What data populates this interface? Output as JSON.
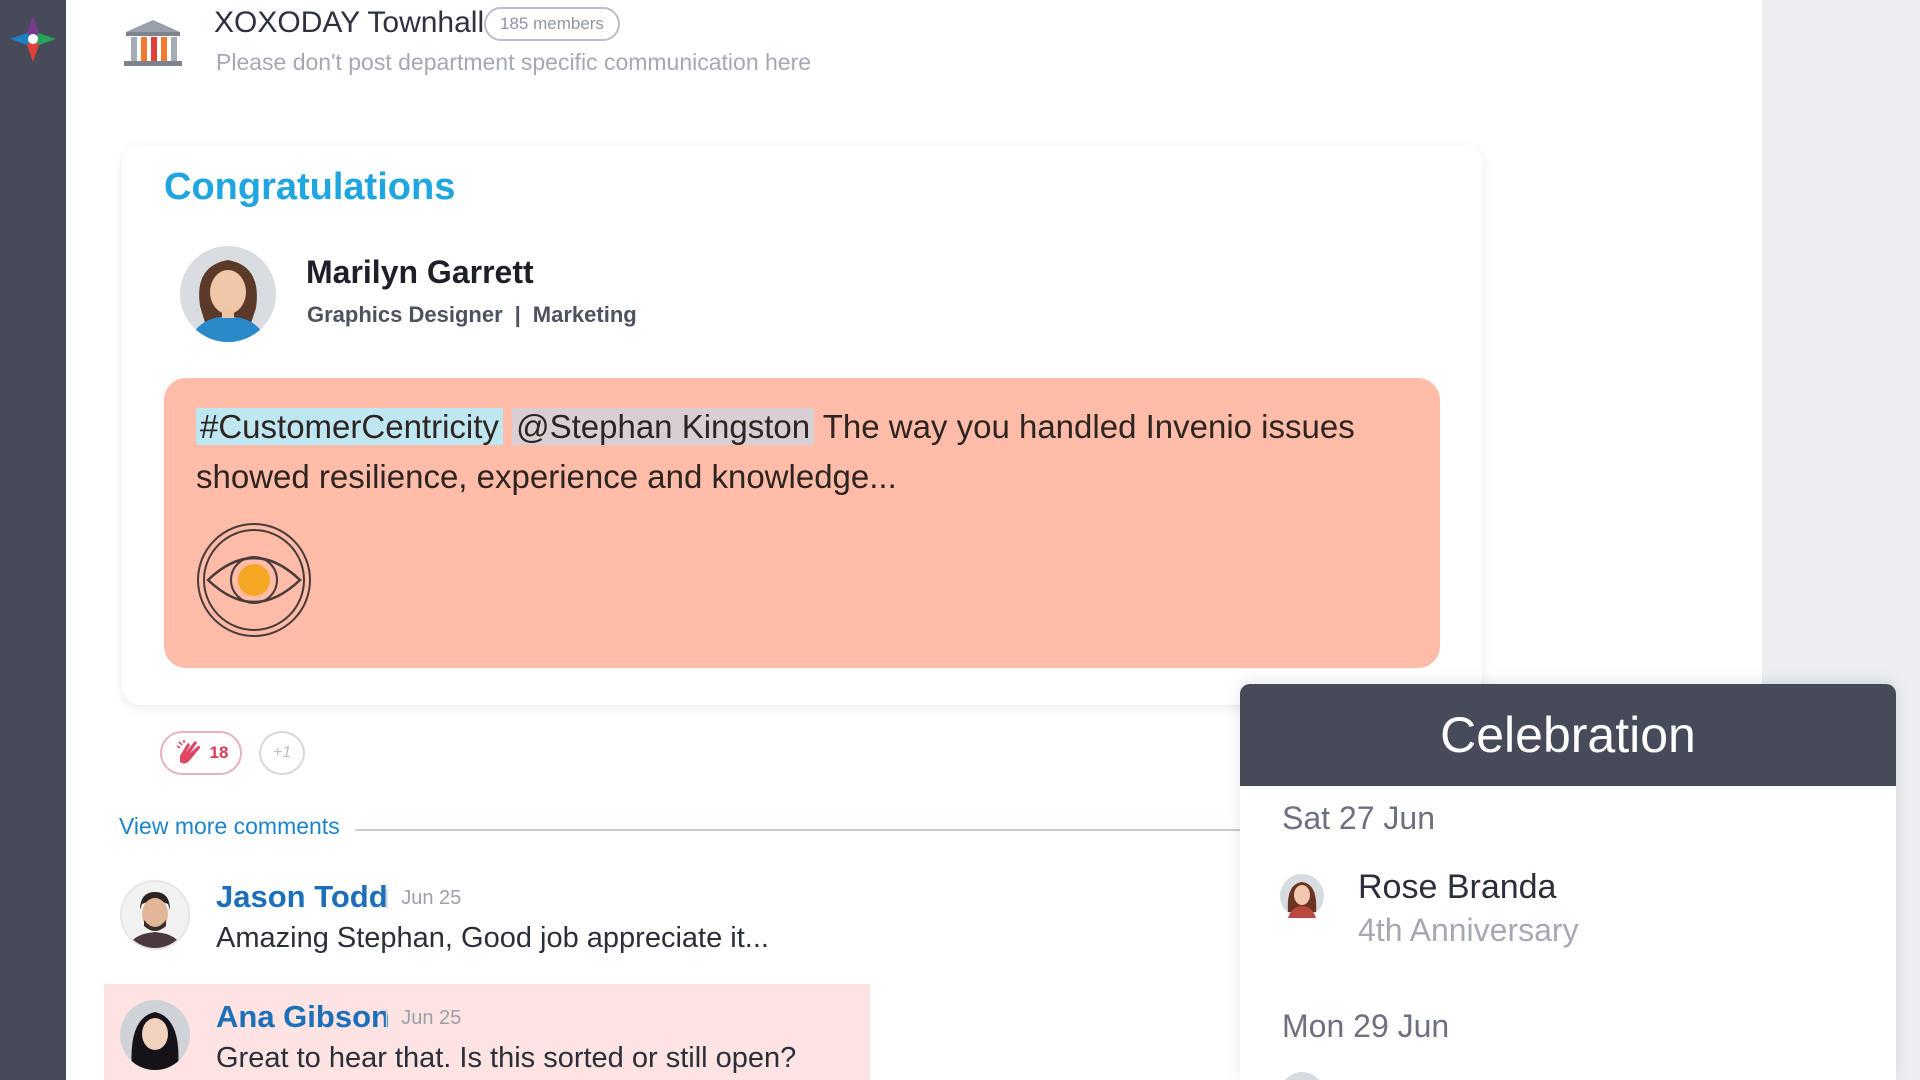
{
  "group": {
    "title": "XOXODAY Townhall",
    "members": "185 members",
    "description": "Please don't post department specific communication here"
  },
  "post": {
    "heading": "Congratulations",
    "person": {
      "name": "Marilyn Garrett",
      "role": "Graphics Designer",
      "separator": "|",
      "department": "Marketing"
    },
    "message": {
      "hashtag": "#CustomerCentricity",
      "mention": "@Stephan Kingston",
      "text": " The way you handled Invenio issues showed resilience, experience and knowledge..."
    },
    "value_icon": "eye-icon",
    "accent_color": "#ffbca8"
  },
  "reactions": {
    "clap_icon": "clap-icon",
    "clap_count": "18",
    "plus_one": "+1"
  },
  "comments": {
    "view_more": "View more comments",
    "items": [
      {
        "name": "Jason Todd",
        "date": "Jun 25",
        "text": "Amazing Stephan, Good job appreciate it..."
      },
      {
        "name": "Ana Gibson",
        "date": "Jun 25",
        "text": "Great to hear that. Is this sorted or still open?"
      }
    ]
  },
  "celebration": {
    "title": "Celebration",
    "groups": [
      {
        "date": "Sat 27 Jun",
        "name": "Rose Branda",
        "event": "4th Anniversary"
      },
      {
        "date": "Mon 29 Jun"
      }
    ]
  },
  "colors": {
    "rail": "#474a58",
    "heading_blue": "#1fa6e0",
    "link_blue": "#1c84c9"
  }
}
